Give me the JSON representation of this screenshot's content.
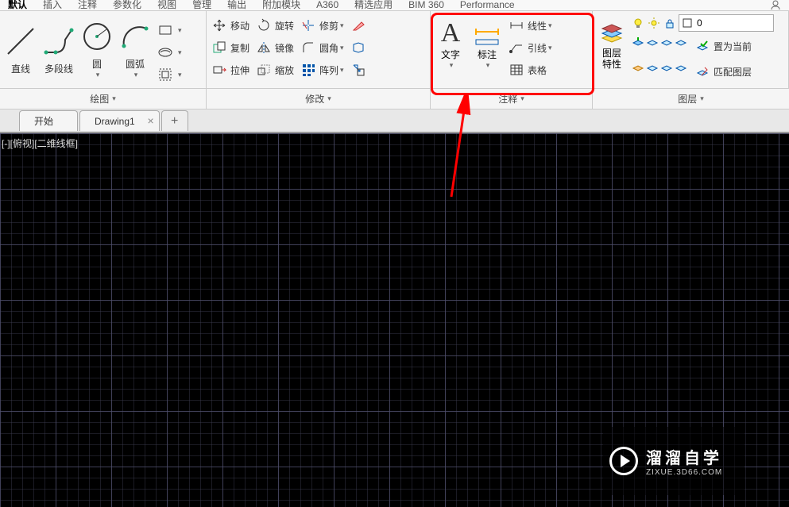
{
  "menu": {
    "items": [
      "默认",
      "插入",
      "注释",
      "参数化",
      "视图",
      "管理",
      "输出",
      "附加模块",
      "A360",
      "精选应用",
      "BIM 360",
      "Performance"
    ],
    "active_index": 0
  },
  "ribbon": {
    "draw": {
      "line": "直线",
      "polyline": "多段线",
      "circle": "圆",
      "arc": "圆弧",
      "panel": "绘图"
    },
    "modify": {
      "move": "移动",
      "copy": "复制",
      "stretch": "拉伸",
      "rotate": "旋转",
      "mirror": "镜像",
      "scale": "缩放",
      "trim": "修剪",
      "fillet": "圆角",
      "array": "阵列",
      "panel": "修改"
    },
    "annotate": {
      "text": "文字",
      "dim": "标注",
      "linear": "线性",
      "leader": "引线",
      "table": "表格",
      "panel": "注释"
    },
    "layer": {
      "props": "图层\n特性",
      "setcurrent": "置为当前",
      "match": "匹配图层",
      "name": "0",
      "panel": "图层"
    }
  },
  "tabs": {
    "start": "开始",
    "drawing": "Drawing1"
  },
  "view": {
    "label": "[-][俯视][二维线框]"
  },
  "watermark": {
    "line1": "溜溜自学",
    "line2": "ZIXUE.3D66.COM"
  },
  "panel_titles": {
    "draw": "绘图",
    "modify": "修改",
    "annotate": "注释",
    "layer": "图层"
  }
}
